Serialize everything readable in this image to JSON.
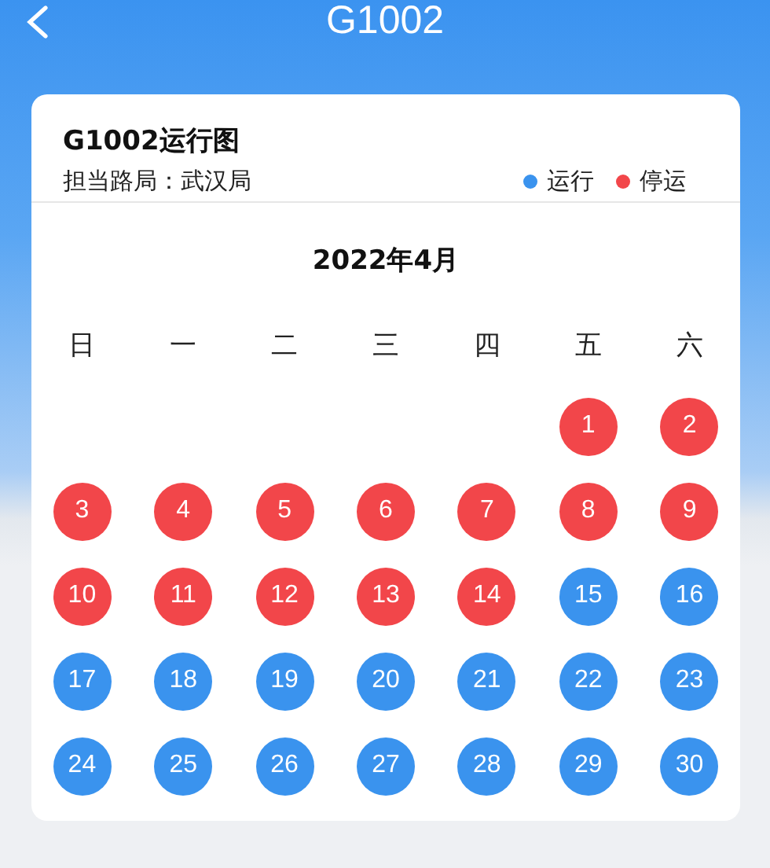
{
  "nav": {
    "title": "G1002"
  },
  "card": {
    "title": "G1002运行图",
    "bureau_label": "担当路局：武汉局",
    "legend": [
      {
        "label": "运行",
        "color": "#3a93ee"
      },
      {
        "label": "停运",
        "color": "#f2464a"
      }
    ]
  },
  "calendar": {
    "month": "2022年4月",
    "weekdays": [
      "日",
      "一",
      "二",
      "三",
      "四",
      "五",
      "六"
    ],
    "days": [
      {
        "kind": "blank"
      },
      {
        "kind": "blank"
      },
      {
        "kind": "blank"
      },
      {
        "kind": "blank"
      },
      {
        "kind": "blank"
      },
      {
        "kind": "day",
        "label": "1",
        "color": "#f2464a"
      },
      {
        "kind": "day",
        "label": "2",
        "color": "#f2464a"
      },
      {
        "kind": "day",
        "label": "3",
        "color": "#f2464a"
      },
      {
        "kind": "day",
        "label": "4",
        "color": "#f2464a"
      },
      {
        "kind": "day",
        "label": "5",
        "color": "#f2464a"
      },
      {
        "kind": "day",
        "label": "6",
        "color": "#f2464a"
      },
      {
        "kind": "day",
        "label": "7",
        "color": "#f2464a"
      },
      {
        "kind": "day",
        "label": "8",
        "color": "#f2464a"
      },
      {
        "kind": "day",
        "label": "9",
        "color": "#f2464a"
      },
      {
        "kind": "day",
        "label": "10",
        "color": "#f2464a"
      },
      {
        "kind": "day",
        "label": "11",
        "color": "#f2464a"
      },
      {
        "kind": "day",
        "label": "12",
        "color": "#f2464a"
      },
      {
        "kind": "day",
        "label": "13",
        "color": "#f2464a"
      },
      {
        "kind": "day",
        "label": "14",
        "color": "#f2464a"
      },
      {
        "kind": "day",
        "label": "15",
        "color": "#3a93ee"
      },
      {
        "kind": "day",
        "label": "16",
        "color": "#3a93ee"
      },
      {
        "kind": "day",
        "label": "17",
        "color": "#3a93ee"
      },
      {
        "kind": "day",
        "label": "18",
        "color": "#3a93ee"
      },
      {
        "kind": "day",
        "label": "19",
        "color": "#3a93ee"
      },
      {
        "kind": "day",
        "label": "20",
        "color": "#3a93ee"
      },
      {
        "kind": "day",
        "label": "21",
        "color": "#3a93ee"
      },
      {
        "kind": "day",
        "label": "22",
        "color": "#3a93ee"
      },
      {
        "kind": "day",
        "label": "23",
        "color": "#3a93ee"
      },
      {
        "kind": "day",
        "label": "24",
        "color": "#3a93ee"
      },
      {
        "kind": "day",
        "label": "25",
        "color": "#3a93ee"
      },
      {
        "kind": "day",
        "label": "26",
        "color": "#3a93ee"
      },
      {
        "kind": "day",
        "label": "27",
        "color": "#3a93ee"
      },
      {
        "kind": "day",
        "label": "28",
        "color": "#3a93ee"
      },
      {
        "kind": "day",
        "label": "29",
        "color": "#3a93ee"
      },
      {
        "kind": "day",
        "label": "30",
        "color": "#3a93ee"
      }
    ]
  }
}
